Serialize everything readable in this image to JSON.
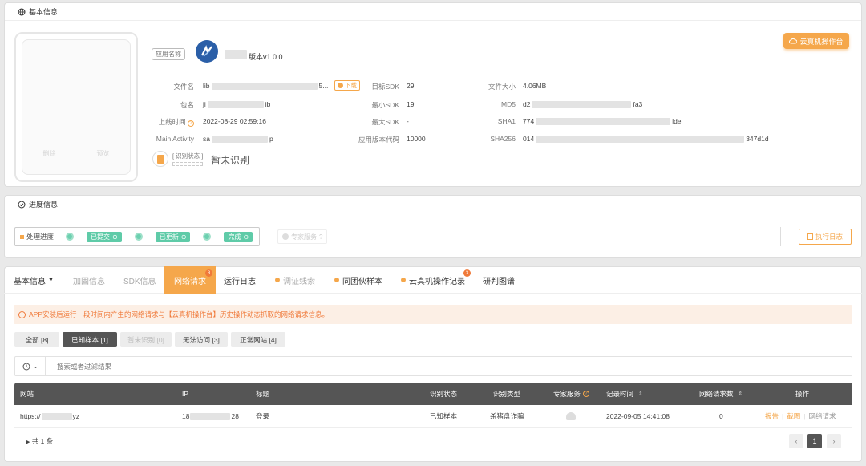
{
  "basic": {
    "header": "基本信息",
    "app_name_label": "应用名称",
    "version_text": "版本v1.0.0",
    "phone_btn_left": "删除",
    "phone_btn_right": "预览",
    "cloud_button": "云真机操作台",
    "fields": {
      "file_name_label": "文件名",
      "file_name_value_prefix": "lib",
      "file_name_value_suffix": "5...",
      "download_tag": "下载",
      "package_label": "包名",
      "package_value_prefix": "ji",
      "package_value_suffix": "ib",
      "online_time_label": "上线时间",
      "online_time_value": "2022-08-29 02:59:16",
      "main_activity_label": "Main Activity",
      "main_activity_prefix": "sa",
      "main_activity_suffix": "p",
      "target_sdk_label": "目标SDK",
      "target_sdk_value": "29",
      "min_sdk_label": "最小SDK",
      "min_sdk_value": "19",
      "max_sdk_label": "最大SDK",
      "max_sdk_value": "-",
      "version_code_label": "应用版本代码",
      "version_code_value": "10000",
      "file_size_label": "文件大小",
      "file_size_value": "4.06MB",
      "md5_label": "MD5",
      "md5_prefix": "d2",
      "md5_suffix": "fa3",
      "sha1_label": "SHA1",
      "sha1_prefix": "774",
      "sha1_suffix": "lde",
      "sha256_label": "SHA256",
      "sha256_prefix": "014",
      "sha256_suffix": "347d1d"
    },
    "recog_status_label": "识别状态",
    "recog_status_value": "暂未识别"
  },
  "progress": {
    "header": "进度信息",
    "process_label": "处理进度",
    "steps": [
      "已提交",
      "已更新",
      "完成"
    ],
    "expert_service": "专家服务",
    "exec_log": "执行日志"
  },
  "tabs": [
    {
      "label": "基本信息",
      "state": "dropdown"
    },
    {
      "label": "加固信息",
      "state": "dim"
    },
    {
      "label": "SDK信息",
      "state": "dim"
    },
    {
      "label": "网络请求",
      "state": "active",
      "badge": "8"
    },
    {
      "label": "运行日志",
      "state": "normal"
    },
    {
      "label": "调证线索",
      "state": "dim"
    },
    {
      "label": "同团伙样本",
      "state": "normal"
    },
    {
      "label": "云真机操作记录",
      "state": "normal",
      "badge": "3"
    },
    {
      "label": "研判图谱",
      "state": "normal"
    }
  ],
  "notice": "APP安装后运行一段时间内产生的网络请求与【云真机操作台】历史操作动态抓取的网络请求信息。",
  "filters": [
    "全部 [8]",
    "已知样本 [1]",
    "暂未识别 [0]",
    "无法访问 [3]",
    "正常网站 [4]"
  ],
  "search": {
    "placeholder": "搜索或者过滤结果"
  },
  "table": {
    "headers": [
      "网站",
      "IP",
      "标题",
      "识别状态",
      "识别类型",
      "专家服务",
      "记录时间",
      "网络请求数",
      "操作"
    ],
    "row": {
      "site_prefix": "https://",
      "site_suffix": "yz",
      "ip_prefix": "18",
      "ip_suffix": "28",
      "title": "登录",
      "status": "已知样本",
      "type": "杀猪盘诈骗",
      "time": "2022-09-05 14:41:08",
      "count": "0",
      "actions": [
        "报告",
        "截图",
        "网络请求"
      ]
    }
  },
  "footer": {
    "total": "共 1 条",
    "page": "1"
  },
  "colors": {
    "accent": "#f5a74b",
    "green": "#5fcba8",
    "table_header": "#555555"
  }
}
